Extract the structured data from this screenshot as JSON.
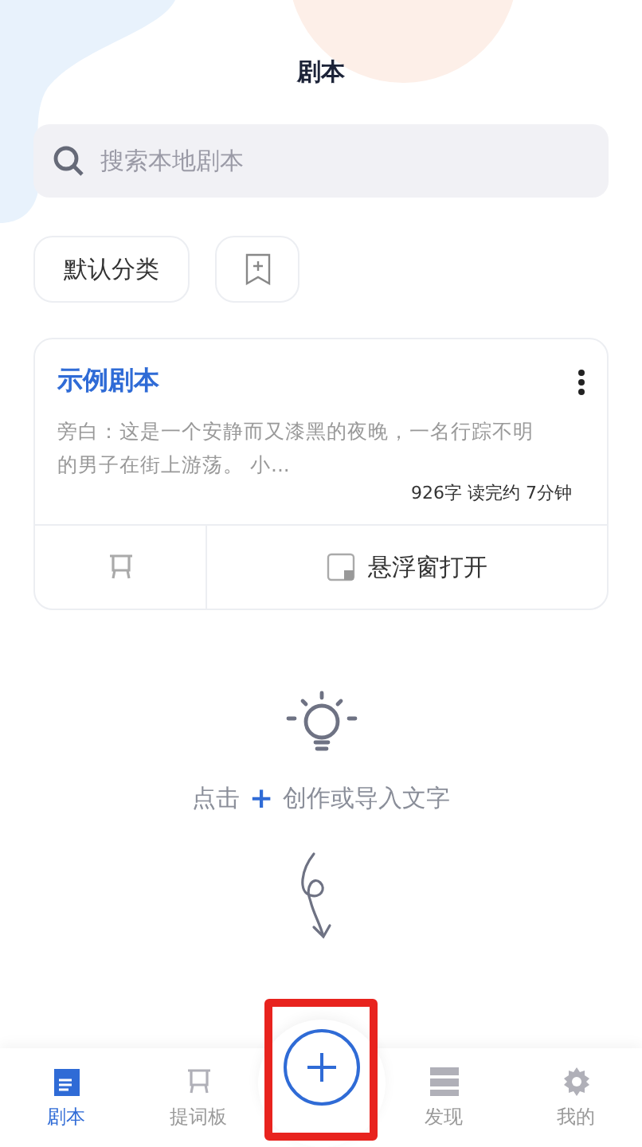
{
  "header": {
    "title": "剧本"
  },
  "search": {
    "placeholder": "搜索本地剧本"
  },
  "categories": [
    {
      "kind": "chip",
      "label": "默认分类"
    },
    {
      "kind": "add"
    }
  ],
  "scripts": [
    {
      "title": "示例剧本",
      "excerpt": "旁白：这是一个安静而又漆黑的夜晚，一名行踪不明的男子在街上游荡。 小...",
      "stats": "926字 读完约 7分钟",
      "float_label": "悬浮窗打开"
    }
  ],
  "empty_hint": {
    "before": "点击",
    "plus": "+",
    "after": "创作或导入文字"
  },
  "nav": [
    {
      "kind": "tab",
      "label": "剧本",
      "selected": true
    },
    {
      "kind": "tab",
      "label": "提词板",
      "selected": false
    },
    {
      "kind": "add",
      "highlighted": true
    },
    {
      "kind": "tab",
      "label": "发现",
      "selected": false
    },
    {
      "kind": "tab",
      "label": "我的",
      "selected": false
    }
  ]
}
